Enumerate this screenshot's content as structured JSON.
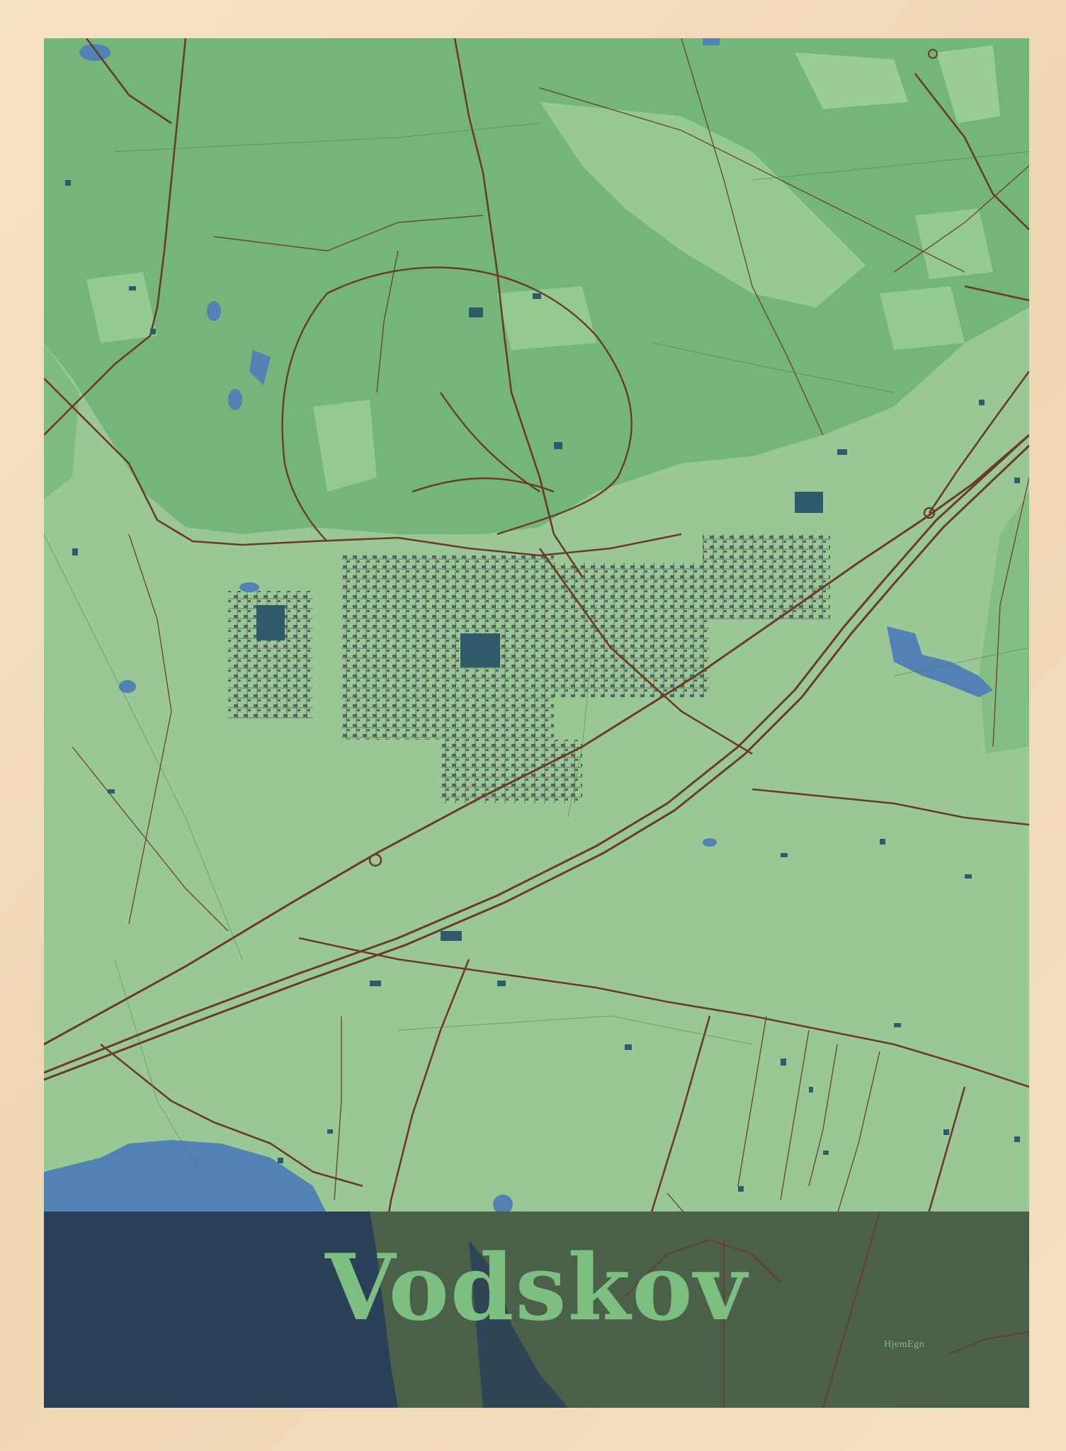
{
  "poster": {
    "city_name": "Vodskov",
    "brand": "HjemEgn"
  },
  "colors": {
    "frame": "#f3dcbc",
    "farmland": "#9ac796",
    "forest": "#74b679",
    "light_field": "#b4dba8",
    "roads": "#6b3a2a",
    "water": "#5282b4",
    "buildings": "#2f5a6a",
    "title_band_water": "#2a4058",
    "title_band_land": "#4a6048",
    "title_text": "#7cbf80"
  },
  "icons": {
    "map": "city-map-illustration"
  }
}
